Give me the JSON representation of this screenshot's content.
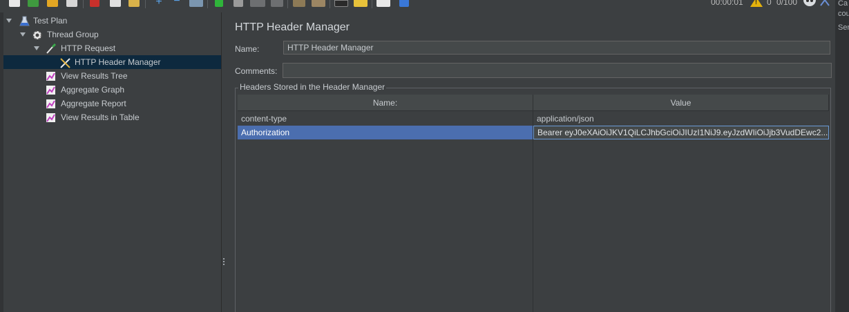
{
  "toolbar": {
    "timer": "00:00:01",
    "warning_count": "0",
    "threads": "0/100",
    "icons": [
      "new-icon",
      "templates-icon",
      "open-icon",
      "save-icon",
      "cut-icon",
      "copy-icon",
      "paste-icon",
      "expand-icon",
      "collapse-icon",
      "toggle-icon",
      "start-icon",
      "start-no-pause-icon",
      "stop-icon",
      "shutdown-icon",
      "clear-icon",
      "clear-all-icon",
      "search-icon",
      "reset-search-icon",
      "function-helper-icon",
      "help-icon"
    ]
  },
  "tree": {
    "items": [
      {
        "label": "Test Plan",
        "icon": "flask-icon"
      },
      {
        "label": "Thread Group",
        "icon": "gear-icon"
      },
      {
        "label": "HTTP Request",
        "icon": "pipette-icon"
      },
      {
        "label": "HTTP Header Manager",
        "icon": "tools-icon"
      },
      {
        "label": "View Results Tree",
        "icon": "graph-icon"
      },
      {
        "label": "Aggregate Graph",
        "icon": "graph-icon"
      },
      {
        "label": "Aggregate Report",
        "icon": "graph-icon"
      },
      {
        "label": "View Results in Table",
        "icon": "graph-icon"
      }
    ]
  },
  "panel": {
    "title": "HTTP Header Manager",
    "name_label": "Name:",
    "name_value": "HTTP Header Manager",
    "comments_label": "Comments:",
    "comments_value": "",
    "group_title": "Headers Stored in the Header Manager",
    "table": {
      "columns": [
        "Name:",
        "Value"
      ],
      "rows": [
        {
          "name": "content-type",
          "value": "application/json"
        },
        {
          "name": "Authorization",
          "value": "Bearer eyJ0eXAiOiJKV1QiLCJhbGciOiJIUzI1NiJ9.eyJzdWIiOiJjb3VudDEwc2..."
        }
      ]
    }
  },
  "edge_fragments": [
    "Ca",
    "cou",
    "Ser"
  ],
  "colors": {
    "selection": "#4b6eaf",
    "tree_selection": "#0d293e",
    "background": "#3c3f41"
  }
}
